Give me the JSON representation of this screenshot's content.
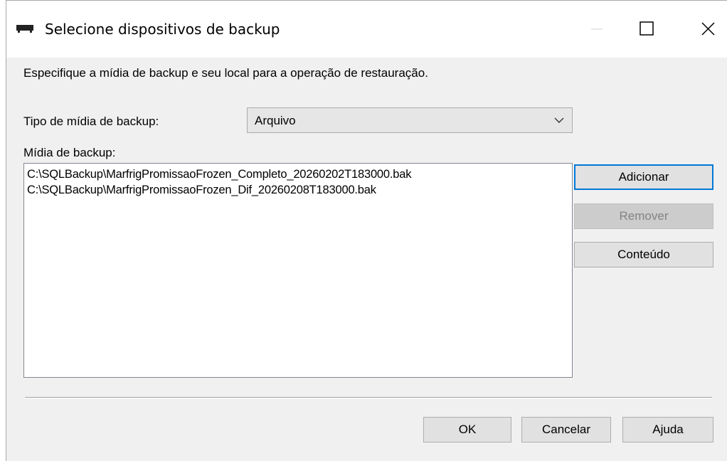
{
  "window": {
    "title": "Selecione dispositivos de backup",
    "icon": "tape-drive-icon"
  },
  "instruction": "Especifique a mídia de backup e seu local para a operação de restauração.",
  "media_type": {
    "label": "Tipo de mídia de backup:",
    "selected": "Arquivo"
  },
  "media_list": {
    "label": "Mídia de backup:",
    "items": [
      "C:\\SQLBackup\\MarfrigPromissaoFrozen_Completo_20260202T183000.bak",
      "C:\\SQLBackup\\MarfrigPromissaoFrozen_Dif_20260208T183000.bak"
    ]
  },
  "side_buttons": {
    "add": "Adicionar",
    "remove": "Remover",
    "content": "Conteúdo"
  },
  "footer_buttons": {
    "ok": "OK",
    "cancel": "Cancelar",
    "help": "Ajuda"
  },
  "colors": {
    "accent": "#0078d7",
    "dialog_bg": "#f0f0f0",
    "disabled_text": "#838383"
  }
}
